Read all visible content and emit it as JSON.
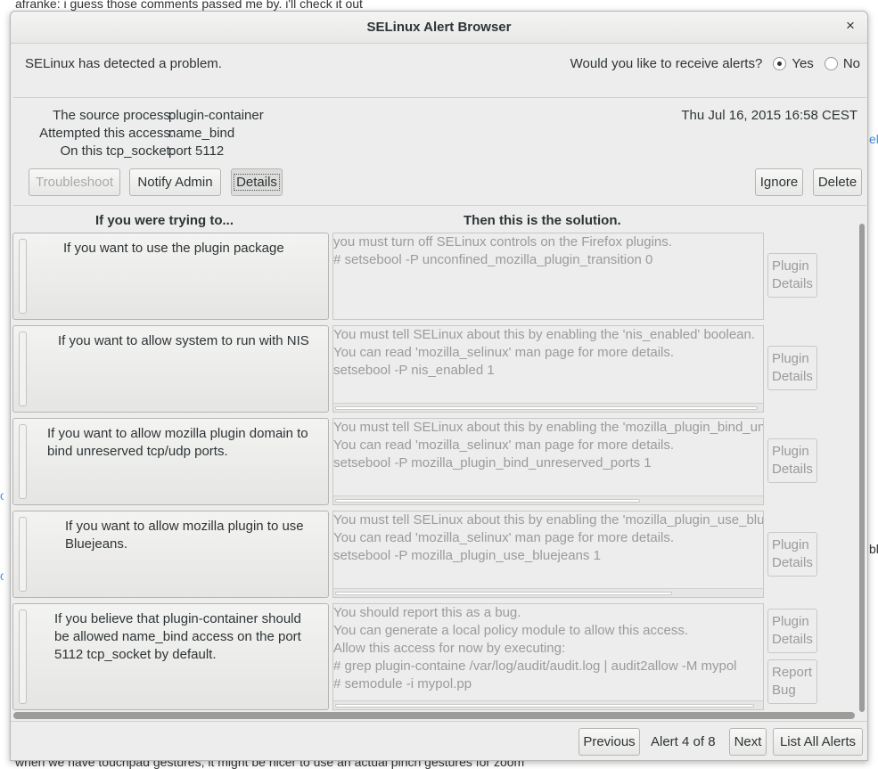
{
  "background": {
    "top_text": "afranke: i guess those comments passed me by. i'll check it out",
    "bottom_text": "when we have touchpad gestures, it might be nicer to use an actual pinch gestures for zoom",
    "right_fragment_1": "el",
    "right_fragment_2": "bl",
    "left_fragment": "o"
  },
  "window": {
    "title": "SELinux Alert Browser",
    "close_glyph": "×"
  },
  "header": {
    "problem_text": "SELinux has detected a problem.",
    "receive_question": "Would you like to receive alerts?",
    "yes_label": "Yes",
    "no_label": "No",
    "selected": "Yes"
  },
  "info": {
    "source_label": "The source process:",
    "source_value": "plugin-container",
    "access_label": "Attempted this access:",
    "access_value": "name_bind",
    "target_label": "On this tcp_socket:",
    "target_value": "port 5112",
    "datetime": "Thu Jul 16, 2015 16:58 CEST"
  },
  "actions": {
    "troubleshoot": "Troubleshoot",
    "notify_admin": "Notify Admin",
    "details": "Details",
    "ignore": "Ignore",
    "delete": "Delete"
  },
  "columns": {
    "left": "If you were trying to...",
    "right": "Then this is the solution."
  },
  "rows": [
    {
      "trying": "If you want to use the plugin package",
      "solution": "you must turn off SELinux controls on the Firefox plugins.\n# setsebool -P unconfined_mozilla_plugin_transition 0",
      "side_buttons": [
        "Plugin\nDetails"
      ]
    },
    {
      "trying": "If you want to allow system to run with NIS",
      "solution": "You must tell SELinux about this by enabling the 'nis_enabled' boolean.\nYou can read 'mozilla_selinux' man page for more details.\nsetsebool -P nis_enabled 1",
      "side_buttons": [
        "Plugin\nDetails"
      ]
    },
    {
      "trying": "If you want to allow mozilla plugin domain to bind unreserved tcp/udp ports.",
      "solution": "You must tell SELinux about this by enabling the 'mozilla_plugin_bind_unreserved_ports' boolean.\nYou can read 'mozilla_selinux' man page for more details.\nsetsebool -P mozilla_plugin_bind_unreserved_ports 1",
      "side_buttons": [
        "Plugin\nDetails"
      ]
    },
    {
      "trying": "If you want to allow mozilla plugin to use Bluejeans.",
      "solution": "You must tell SELinux about this by enabling the 'mozilla_plugin_use_bluejeans' boolean.\nYou can read 'mozilla_selinux' man page for more details.\nsetsebool -P mozilla_plugin_use_bluejeans 1",
      "side_buttons": [
        "Plugin\nDetails"
      ]
    },
    {
      "trying": "If you believe that plugin-container should be allowed name_bind access on the port 5112 tcp_socket by default.",
      "solution": "You should report this as a bug.\nYou can generate a local policy module to allow this access.\nAllow this access for now by executing:\n# grep plugin-containe /var/log/audit/audit.log | audit2allow -M mypol\n# semodule -i mypol.pp",
      "side_buttons": [
        "Plugin\nDetails",
        "Report\nBug"
      ]
    }
  ],
  "footer": {
    "previous": "Previous",
    "alert_count": "Alert 4 of 8",
    "next": "Next",
    "list_all": "List All Alerts"
  }
}
